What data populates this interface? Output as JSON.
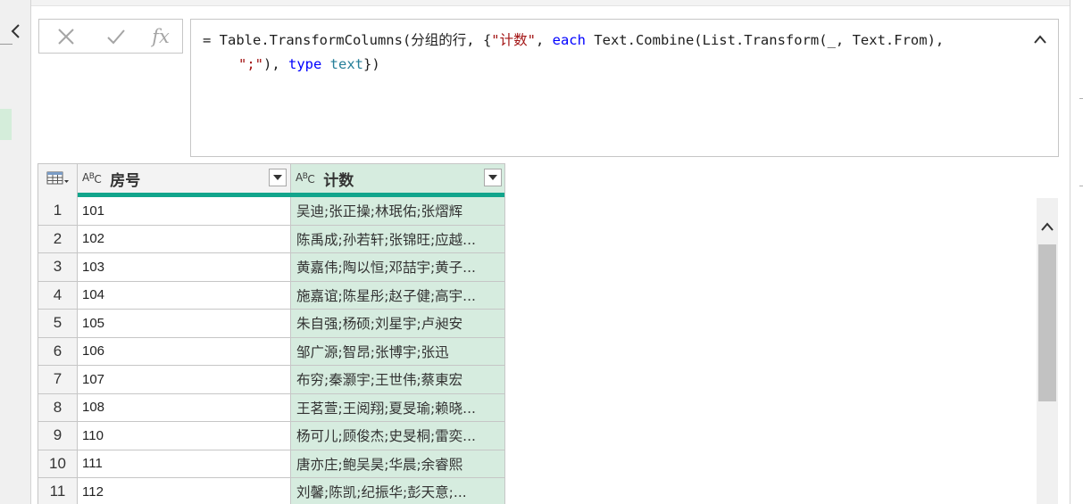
{
  "formula_bar": {
    "cancel_icon": "close-icon",
    "commit_icon": "check-icon",
    "fx_label": "fx",
    "tokens": {
      "t1": "= Table.TransformColumns(分组的行, {",
      "t2": "\"计数\"",
      "t3": ", ",
      "t4": "each",
      "t5": " Text.Combine(List.Transform(_, Text.From),",
      "t6": "\";\"",
      "t7": "), ",
      "t8": "type",
      "t9": " ",
      "t10": "text",
      "t11": "})"
    },
    "colors": {
      "string": "#a31515",
      "keyword": "#0000ff",
      "type": "#267f99"
    }
  },
  "grid": {
    "columns": [
      {
        "type_label": "ABC",
        "name": "房号"
      },
      {
        "type_label": "ABC",
        "name": "计数"
      }
    ],
    "quality_bar_color": "#12a58c",
    "selected_column_color": "#d6ecdf",
    "rows": [
      {
        "index": "1",
        "room": "101",
        "count": "吴迪;张正操;林珉佑;张熠辉"
      },
      {
        "index": "2",
        "room": "102",
        "count": "陈禹成;孙若轩;张锦旺;应越..."
      },
      {
        "index": "3",
        "room": "103",
        "count": "黄嘉伟;陶以恒;邓喆宇;黄子..."
      },
      {
        "index": "4",
        "room": "104",
        "count": "施嘉谊;陈星彤;赵子健;高宇..."
      },
      {
        "index": "5",
        "room": "105",
        "count": "朱自强;杨硕;刘星宇;卢昶安"
      },
      {
        "index": "6",
        "room": "106",
        "count": "邹广源;智昂;张博宇;张迅"
      },
      {
        "index": "7",
        "room": "107",
        "count": "布穷;秦灏宇;王世伟;蔡東宏"
      },
      {
        "index": "8",
        "room": "108",
        "count": "王茗萱;王阅翔;夏旻瑜;赖晓..."
      },
      {
        "index": "9",
        "room": "110",
        "count": "杨可儿;顾俊杰;史旻桐;雷奕..."
      },
      {
        "index": "10",
        "room": "111",
        "count": "唐亦庄;鲍吴昊;华晨;余睿熙"
      },
      {
        "index": "11",
        "room": "112",
        "count": "刘馨;陈凯;纪振华;彭天意;..."
      }
    ]
  }
}
